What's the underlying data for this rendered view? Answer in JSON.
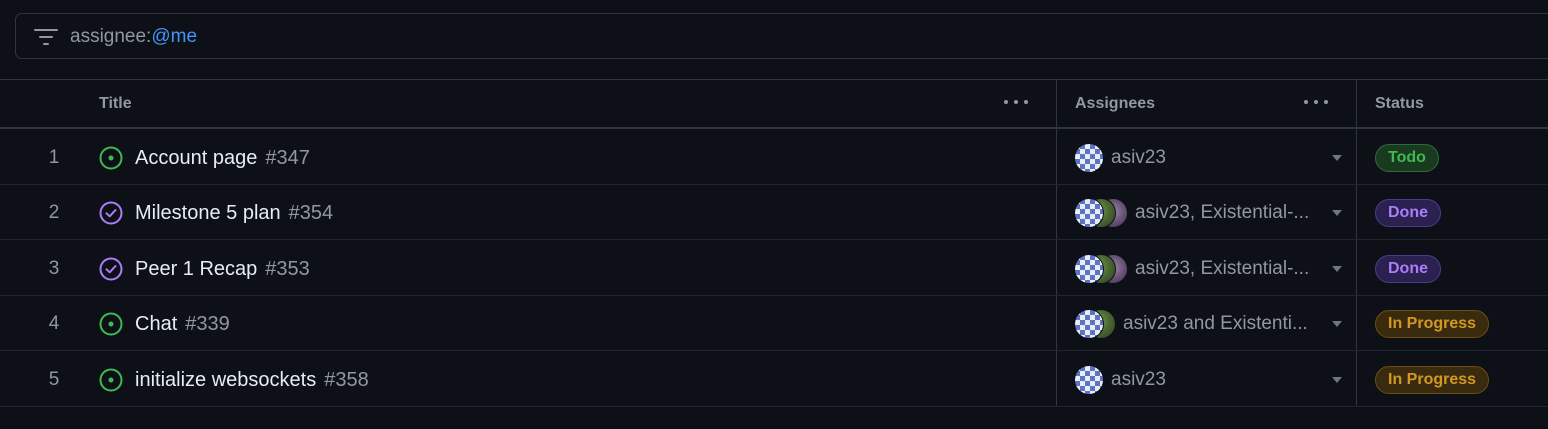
{
  "filter": {
    "key": "assignee:",
    "value": "@me",
    "icon": "filter-icon"
  },
  "columns": {
    "title": "Title",
    "assignees": "Assignees",
    "status": "Status"
  },
  "rows": [
    {
      "num": "1",
      "state": "open",
      "title": "Account page",
      "issue": "#347",
      "avatars": [
        "checker"
      ],
      "assignees": "asiv23",
      "status": "Todo",
      "status_kind": "todo"
    },
    {
      "num": "2",
      "state": "closed",
      "title": "Milestone 5 plan",
      "issue": "#354",
      "avatars": [
        "checker",
        "green",
        "purple"
      ],
      "assignees": "asiv23, Existential-...",
      "status": "Done",
      "status_kind": "done"
    },
    {
      "num": "3",
      "state": "closed",
      "title": "Peer 1 Recap",
      "issue": "#353",
      "avatars": [
        "checker",
        "green",
        "purple"
      ],
      "assignees": "asiv23, Existential-...",
      "status": "Done",
      "status_kind": "done"
    },
    {
      "num": "4",
      "state": "open",
      "title": "Chat",
      "issue": "#339",
      "avatars": [
        "checker",
        "green"
      ],
      "assignees": "asiv23 and Existenti...",
      "status": "In Progress",
      "status_kind": "progress"
    },
    {
      "num": "5",
      "state": "open",
      "title": "initialize websockets",
      "issue": "#358",
      "avatars": [
        "checker"
      ],
      "assignees": "asiv23",
      "status": "In Progress",
      "status_kind": "progress"
    }
  ],
  "colors": {
    "open": "#3fb950",
    "closed": "#ab7df8",
    "todo": "#3fb950",
    "done": "#ab7df8",
    "progress": "#d29922"
  }
}
